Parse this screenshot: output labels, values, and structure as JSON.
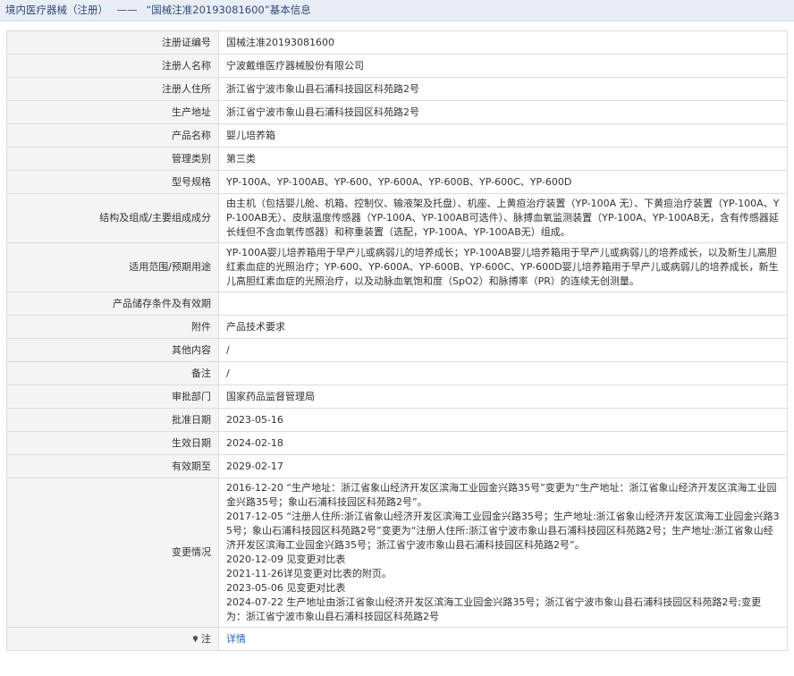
{
  "header": {
    "section": "境内医疗器械（注册）",
    "separator": "——",
    "title": "“国械注准20193081600”基本信息"
  },
  "rows": [
    {
      "label": "注册证编号",
      "value": "国械注准20193081600"
    },
    {
      "label": "注册人名称",
      "value": "宁波戴维医疗器械股份有限公司"
    },
    {
      "label": "注册人住所",
      "value": "浙江省宁波市象山县石浦科技园区科苑路2号"
    },
    {
      "label": "生产地址",
      "value": "浙江省宁波市象山县石浦科技园区科苑路2号"
    },
    {
      "label": "产品名称",
      "value": "婴儿培养箱"
    },
    {
      "label": "管理类别",
      "value": "第三类"
    },
    {
      "label": "型号规格",
      "value": "YP-100A、YP-100AB、YP-600、YP-600A、YP-600B、YP-600C、YP-600D"
    },
    {
      "label": "结构及组成/主要组成成分",
      "value": "由主机（包括婴儿舱、机箱、控制仪、输液架及托盘）、机座、上黄疸治疗装置（YP-100A 无）、下黄疸治疗装置（YP-100A、YP-100AB无）、皮肤温度传感器（YP-100A、YP-100AB可选件）、脉搏血氧监测装置（YP-100A、YP-100AB无，含有传感器延长线但不含血氧传感器）和称重装置（选配，YP-100A、YP-100AB无）组成。"
    },
    {
      "label": "适用范围/预期用途",
      "value": "YP-100A婴儿培养箱用于早产儿或病弱儿的培养成长；YP-100AB婴儿培养箱用于早产儿或病弱儿的培养成长，以及新生儿高胆红素血症的光照治疗；YP-600、YP-600A、YP-600B、YP-600C、YP-600D婴儿培养箱用于早产儿或病弱儿的培养成长，新生儿高胆红素血症的光照治疗，以及动脉血氧饱和度（SpO2）和脉搏率（PR）的连续无创测量。"
    },
    {
      "label": "产品储存条件及有效期",
      "value": ""
    },
    {
      "label": "附件",
      "value": "产品技术要求"
    },
    {
      "label": "其他内容",
      "value": "/"
    },
    {
      "label": "备注",
      "value": "/"
    },
    {
      "label": "审批部门",
      "value": "国家药品监督管理局"
    },
    {
      "label": "批准日期",
      "value": "2023-05-16"
    },
    {
      "label": "生效日期",
      "value": "2024-02-18"
    },
    {
      "label": "有效期至",
      "value": "2029-02-17"
    }
  ],
  "changes": {
    "label": "变更情况",
    "entries": [
      "2016-12-20 “生产地址：浙江省象山经济开发区滨海工业园金兴路35号”变更为“生产地址：浙江省象山经济开发区滨海工业园金兴路35号；象山石浦科技园区科苑路2号”。",
      "2017-12-05 “注册人住所:浙江省象山经济开发区滨海工业园金兴路35号；生产地址:浙江省象山经济开发区滨海工业园金兴路35号；象山石浦科技园区科苑路2号”变更为“注册人住所:浙江省宁波市象山县石浦科技园区科苑路2号；生产地址:浙江省象山经济开发区滨海工业园金兴路35号；浙江省宁波市象山县石浦科技园区科苑路2号”。",
      "2020-12-09 见变更对比表",
      "2021-11-26详见变更对比表的附页。",
      "2023-05-06 见变更对比表",
      "2024-07-22 生产地址由浙江省象山经济开发区滨海工业园金兴路35号；浙江省宁波市象山县石浦科技园区科苑路2号;变更为：浙江省宁波市象山县石浦科技园区科苑路2号"
    ]
  },
  "note": {
    "icon": "pin-icon",
    "label": "注",
    "link_text": "详情"
  }
}
